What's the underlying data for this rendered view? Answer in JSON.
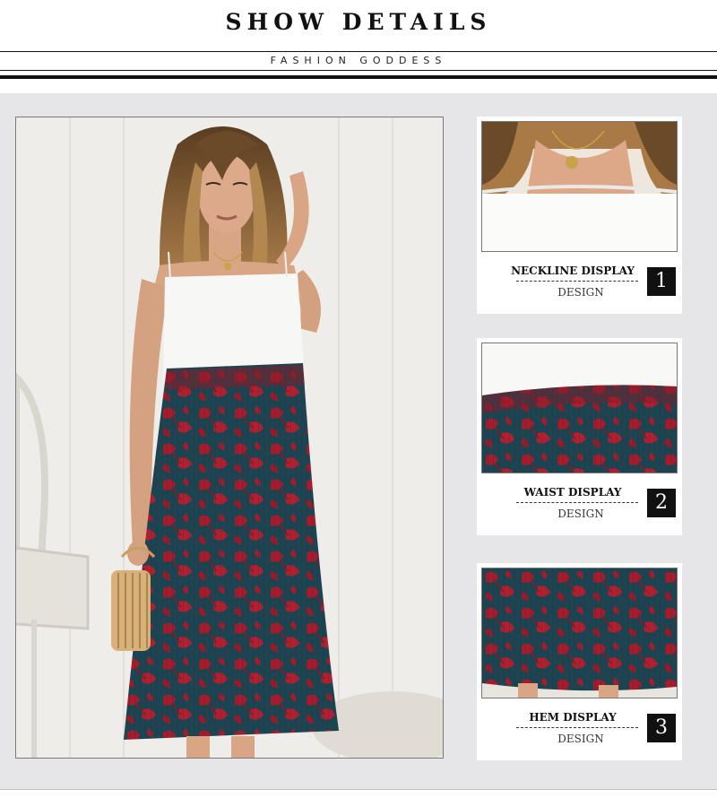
{
  "header": {
    "title": "SHOW DETAILS",
    "subtitle": "FASHION GODDESS"
  },
  "details": [
    {
      "title": "NECKLINE DISPLAY",
      "subtitle": "DESIGN",
      "number": "1"
    },
    {
      "title": "WAIST DISPLAY",
      "subtitle": "DESIGN",
      "number": "2"
    },
    {
      "title": "HEM DISPLAY",
      "subtitle": "DESIGN",
      "number": "3"
    }
  ],
  "colors": {
    "panel": "#e6e6e8",
    "skirt_base": "#1f4451",
    "skirt_flower": "#a51c2c",
    "top": "#f7f7f5",
    "hair": "#8a6236",
    "skin": "#d8a585"
  }
}
